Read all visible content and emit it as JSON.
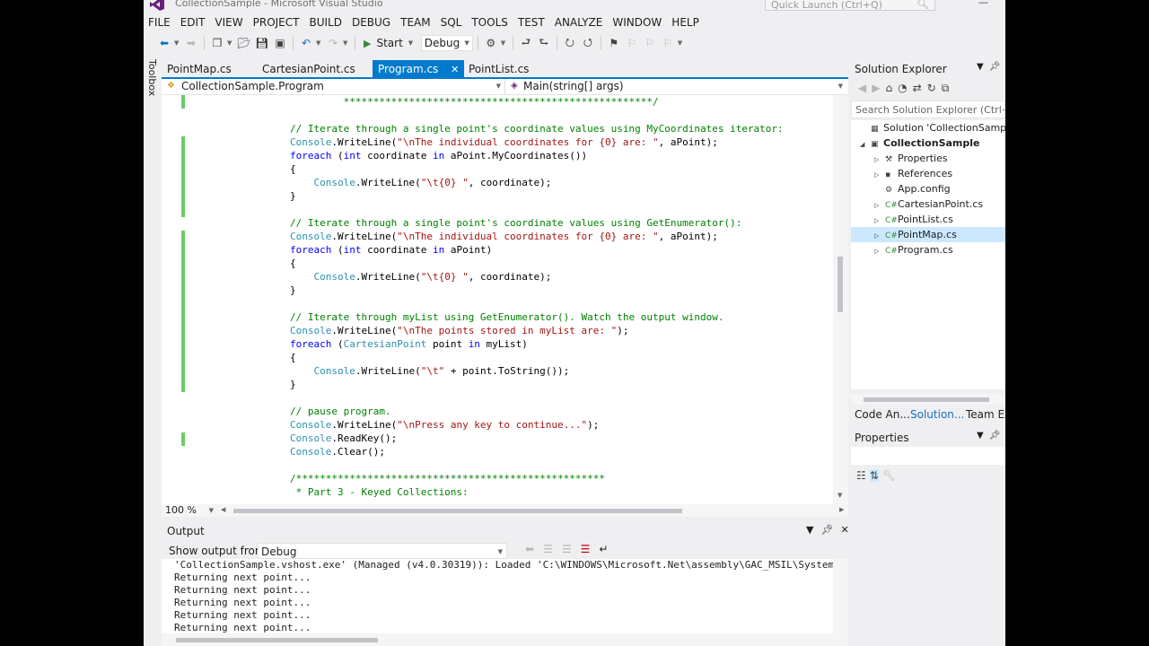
{
  "window": {
    "title": "CollectionSample - Microsoft Visual Studio",
    "quick_launch_placeholder": "Quick Launch (Ctrl+Q)"
  },
  "menu": [
    "FILE",
    "EDIT",
    "VIEW",
    "PROJECT",
    "BUILD",
    "DEBUG",
    "TEAM",
    "SQL",
    "TOOLS",
    "TEST",
    "ANALYZE",
    "WINDOW",
    "HELP"
  ],
  "toolbar": {
    "start_label": "Start",
    "config_value": "Debug"
  },
  "toolbox_label": "Toolbox",
  "tabs": [
    {
      "label": "PointMap.cs",
      "active": false
    },
    {
      "label": "CartesianPoint.cs",
      "active": false
    },
    {
      "label": "Program.cs",
      "active": true,
      "close": "✕"
    },
    {
      "label": "PointList.cs",
      "active": false
    }
  ],
  "navbar": {
    "left": "CollectionSample.Program",
    "right": "Main(string[] args)"
  },
  "editor": {
    "lines": [
      [
        {
          "t": "         ****************************************************/",
          "c": "cm"
        }
      ],
      [
        {
          "t": "",
          "c": ""
        }
      ],
      [
        {
          "t": "// Iterate through a single point's coordinate values using MyCoordinates iterator:",
          "c": "cm"
        }
      ],
      [
        {
          "t": "Console",
          "c": "ty"
        },
        {
          "t": ".WriteLine(",
          "c": ""
        },
        {
          "t": "\"\\nThe individual coordinates for {0} are: \"",
          "c": "st"
        },
        {
          "t": ", aPoint);",
          "c": ""
        }
      ],
      [
        {
          "t": "foreach",
          "c": "kw"
        },
        {
          "t": " (",
          "c": ""
        },
        {
          "t": "int",
          "c": "kw"
        },
        {
          "t": " coordinate ",
          "c": ""
        },
        {
          "t": "in",
          "c": "kw"
        },
        {
          "t": " aPoint.MyCoordinates())",
          "c": ""
        }
      ],
      [
        {
          "t": "{",
          "c": ""
        }
      ],
      [
        {
          "t": "    Console",
          "c": "ty"
        },
        {
          "t": ".WriteLine(",
          "c": ""
        },
        {
          "t": "\"\\t{0} \"",
          "c": "st"
        },
        {
          "t": ", coordinate);",
          "c": ""
        }
      ],
      [
        {
          "t": "}",
          "c": ""
        }
      ],
      [
        {
          "t": "",
          "c": ""
        }
      ],
      [
        {
          "t": "// Iterate through a single point's coordinate values using GetEnumerator():",
          "c": "cm"
        }
      ],
      [
        {
          "t": "Console",
          "c": "ty"
        },
        {
          "t": ".WriteLine(",
          "c": ""
        },
        {
          "t": "\"\\nThe individual coordinates for {0} are: \"",
          "c": "st"
        },
        {
          "t": ", aPoint);",
          "c": ""
        }
      ],
      [
        {
          "t": "foreach",
          "c": "kw"
        },
        {
          "t": " (",
          "c": ""
        },
        {
          "t": "int",
          "c": "kw"
        },
        {
          "t": " coordinate ",
          "c": ""
        },
        {
          "t": "in",
          "c": "kw"
        },
        {
          "t": " aPoint)",
          "c": ""
        }
      ],
      [
        {
          "t": "{",
          "c": ""
        }
      ],
      [
        {
          "t": "    Console",
          "c": "ty"
        },
        {
          "t": ".WriteLine(",
          "c": ""
        },
        {
          "t": "\"\\t{0} \"",
          "c": "st"
        },
        {
          "t": ", coordinate);",
          "c": ""
        }
      ],
      [
        {
          "t": "}",
          "c": ""
        }
      ],
      [
        {
          "t": "",
          "c": ""
        }
      ],
      [
        {
          "t": "// Iterate through myList using GetEnumerator(). Watch the output window.",
          "c": "cm"
        }
      ],
      [
        {
          "t": "Console",
          "c": "ty"
        },
        {
          "t": ".WriteLine(",
          "c": ""
        },
        {
          "t": "\"\\nThe points stored in myList are: \"",
          "c": "st"
        },
        {
          "t": ");",
          "c": ""
        }
      ],
      [
        {
          "t": "foreach",
          "c": "kw"
        },
        {
          "t": " (",
          "c": ""
        },
        {
          "t": "CartesianPoint",
          "c": "ty"
        },
        {
          "t": " point ",
          "c": ""
        },
        {
          "t": "in",
          "c": "kw"
        },
        {
          "t": " myList)",
          "c": ""
        }
      ],
      [
        {
          "t": "{",
          "c": ""
        }
      ],
      [
        {
          "t": "    Console",
          "c": "ty"
        },
        {
          "t": ".WriteLine(",
          "c": ""
        },
        {
          "t": "\"\\t\"",
          "c": "st"
        },
        {
          "t": " + point.ToString());",
          "c": ""
        }
      ],
      [
        {
          "t": "}",
          "c": ""
        }
      ],
      [
        {
          "t": "",
          "c": ""
        }
      ],
      [
        {
          "t": "// pause program.",
          "c": "cm"
        }
      ],
      [
        {
          "t": "Console",
          "c": "ty"
        },
        {
          "t": ".WriteLine(",
          "c": ""
        },
        {
          "t": "\"\\nPress any key to continue...\"",
          "c": "st"
        },
        {
          "t": ");",
          "c": ""
        }
      ],
      [
        {
          "t": "Console",
          "c": "ty"
        },
        {
          "t": ".ReadKey();",
          "c": ""
        }
      ],
      [
        {
          "t": "Console",
          "c": "ty"
        },
        {
          "t": ".Clear();",
          "c": ""
        }
      ],
      [
        {
          "t": "",
          "c": ""
        }
      ],
      [
        {
          "t": "/****************************************************",
          "c": "cm"
        }
      ],
      [
        {
          "t": " * Part 3 - Keyed Collections:",
          "c": "cm"
        }
      ]
    ],
    "zoom": "100 %"
  },
  "output": {
    "title": "Output",
    "source_label": "Show output from:",
    "source_value": "Debug",
    "lines": [
      "'CollectionSample.vshost.exe' (Managed (v4.0.30319)): Loaded 'C:\\WINDOWS\\Microsoft.Net\\assembly\\GAC_MSIL\\System.",
      "Returning next point...",
      "Returning next point...",
      "Returning next point...",
      "Returning next point...",
      "Returning next point..."
    ]
  },
  "solution_explorer": {
    "title": "Solution Explorer",
    "search_placeholder": "Search Solution Explorer (Ctrl+;)",
    "nodes": [
      {
        "label": "Solution 'CollectionSample'",
        "icon": "solution-icon"
      },
      {
        "label": "CollectionSample",
        "icon": "project-icon"
      },
      {
        "label": "Properties",
        "icon": "wrench-icon"
      },
      {
        "label": "References",
        "icon": "references-icon"
      },
      {
        "label": "App.config",
        "icon": "config-icon"
      },
      {
        "label": "CartesianPoint.cs",
        "icon": "csharp-file-icon"
      },
      {
        "label": "PointList.cs",
        "icon": "csharp-file-icon"
      },
      {
        "label": "PointMap.cs",
        "icon": "csharp-file-icon"
      },
      {
        "label": "Program.cs",
        "icon": "csharp-file-icon"
      }
    ],
    "tabs": [
      "Code An...",
      "Solution...",
      "Team Ex"
    ]
  },
  "properties": {
    "title": "Properties"
  },
  "colors": {
    "accent": "#007acc",
    "comment": "#008000",
    "keyword": "#0000ff",
    "string": "#a31515",
    "type": "#2b91af",
    "change_bar": "#6ccb6c"
  }
}
